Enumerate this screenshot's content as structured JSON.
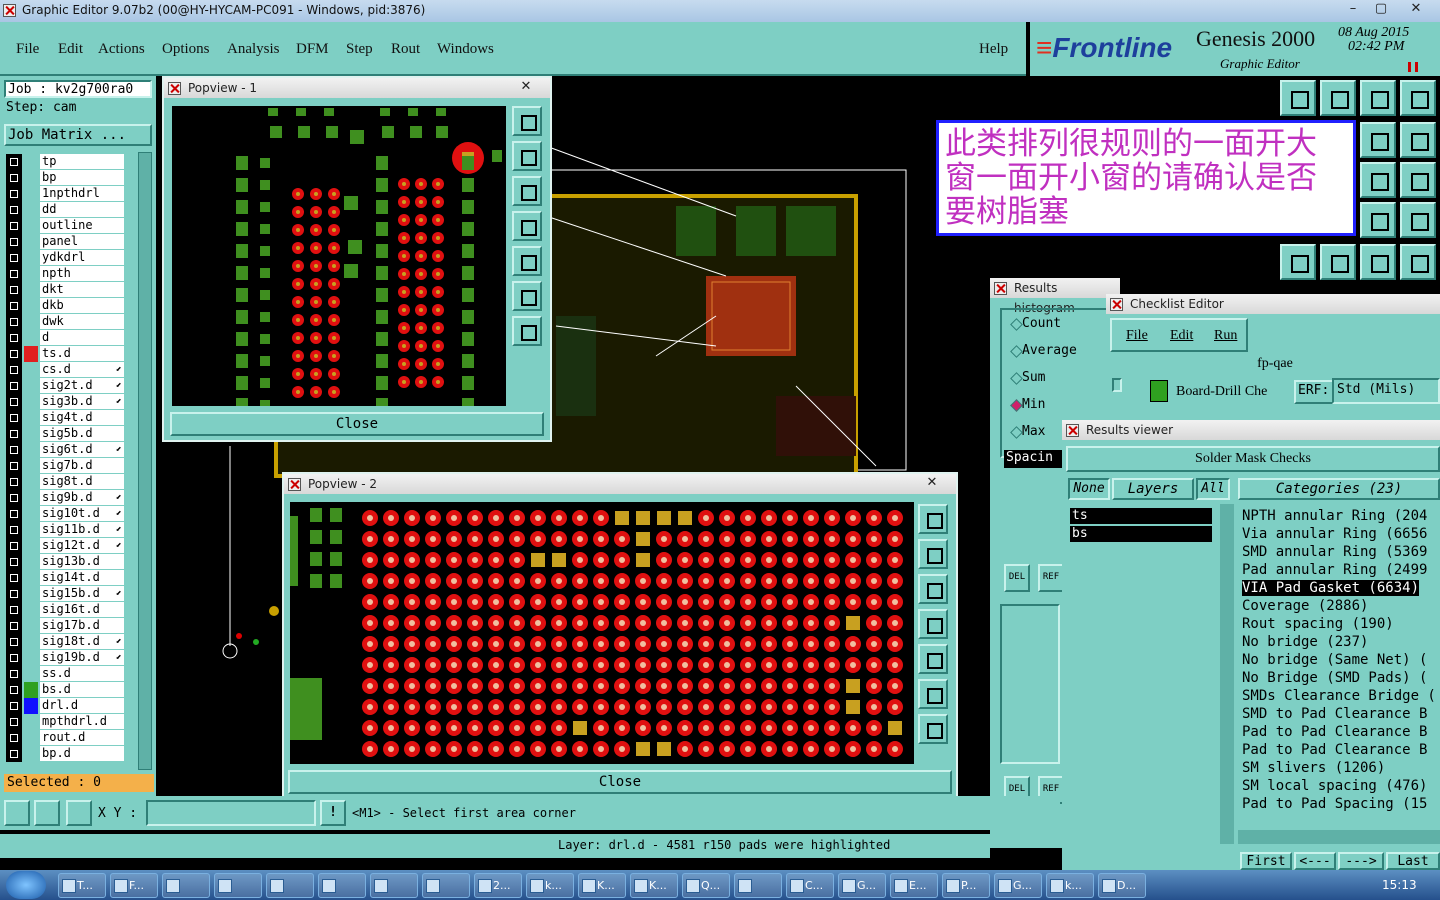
{
  "window": {
    "title": "Graphic Editor 9.07b2 (00@HY-HYCAM-PC091 - Windows, pid:3876)"
  },
  "menu": [
    "File",
    "Edit",
    "Actions",
    "Options",
    "Analysis",
    "DFM",
    "Step",
    "Rout",
    "Windows"
  ],
  "help_label": "Help",
  "brand": {
    "logo": "Frontline",
    "product": "Genesis 2000",
    "subtitle": "Graphic Editor",
    "date": "08 Aug 2015",
    "time": "02:42 PM"
  },
  "job": {
    "job_label": "Job : kv2g700ra0",
    "step_label": "Step: cam",
    "matrix_button": "Job Matrix ..."
  },
  "layers": [
    {
      "name": "tp",
      "color": ""
    },
    {
      "name": "bp",
      "color": ""
    },
    {
      "name": "1npthdrl",
      "color": ""
    },
    {
      "name": "dd",
      "color": ""
    },
    {
      "name": "outline",
      "color": ""
    },
    {
      "name": "panel",
      "color": ""
    },
    {
      "name": "ydkdrl",
      "color": ""
    },
    {
      "name": "npth",
      "color": ""
    },
    {
      "name": "dkt",
      "color": ""
    },
    {
      "name": "dkb",
      "color": ""
    },
    {
      "name": "dwk",
      "color": ""
    },
    {
      "name": "d",
      "color": ""
    },
    {
      "name": "ts.d",
      "color": "#e02020"
    },
    {
      "name": "cs.d",
      "color": ""
    },
    {
      "name": "sig2t.d",
      "color": ""
    },
    {
      "name": "sig3b.d",
      "color": ""
    },
    {
      "name": "sig4t.d",
      "color": ""
    },
    {
      "name": "sig5b.d",
      "color": ""
    },
    {
      "name": "sig6t.d",
      "color": ""
    },
    {
      "name": "sig7b.d",
      "color": ""
    },
    {
      "name": "sig8t.d",
      "color": ""
    },
    {
      "name": "sig9b.d",
      "color": ""
    },
    {
      "name": "sig10t.d",
      "color": ""
    },
    {
      "name": "sig11b.d",
      "color": ""
    },
    {
      "name": "sig12t.d",
      "color": ""
    },
    {
      "name": "sig13b.d",
      "color": ""
    },
    {
      "name": "sig14t.d",
      "color": ""
    },
    {
      "name": "sig15b.d",
      "color": ""
    },
    {
      "name": "sig16t.d",
      "color": ""
    },
    {
      "name": "sig17b.d",
      "color": ""
    },
    {
      "name": "sig18t.d",
      "color": ""
    },
    {
      "name": "sig19b.d",
      "color": ""
    },
    {
      "name": "ss.d",
      "color": ""
    },
    {
      "name": "bs.d",
      "color": "#2fa020"
    },
    {
      "name": "drl.d",
      "color": "#1010ff"
    },
    {
      "name": "mpthdrl.d",
      "color": ""
    },
    {
      "name": "rout.d",
      "color": ""
    },
    {
      "name": "bp.d",
      "color": ""
    }
  ],
  "selected_label": "Selected : 0",
  "xy_label": "X Y :",
  "prompt": "<M1> - Select first area corner",
  "status": "Layer: drl.d - 4581 r150 pads were highlighted",
  "popview1": {
    "title": "Popview - 1",
    "close": "Close"
  },
  "popview2": {
    "title": "Popview - 2",
    "close": "Close"
  },
  "annotation": "此类排列很规则的一面开大窗一面开小窗的请确认是否要树脂塞",
  "histogram": {
    "title": "Results histogram",
    "options": [
      "Count",
      "Average",
      "Sum",
      "Min",
      "Max"
    ],
    "selected": "Min",
    "field": "Spacin",
    "del": "DEL",
    "ref": "REF"
  },
  "checklist": {
    "title": "Checklist Editor",
    "menu": [
      "File",
      "Edit",
      "Run"
    ],
    "name": "fp-qae",
    "item": "Board-Drill Che",
    "erf": "ERF:",
    "units": "Std (Mils)"
  },
  "results": {
    "title": "Results viewer",
    "header": "Solder Mask Checks",
    "buttons": [
      "None",
      "Layers",
      "All"
    ],
    "categories_label": "Categories (23)",
    "layers": [
      "ts",
      "bs"
    ],
    "categories": [
      "NPTH annular Ring (204",
      "Via annular Ring (6656",
      "SMD annular Ring (5369",
      "Pad annular Ring (2499",
      "VIA Pad Gasket (6634)",
      "Coverage (2886)",
      "Rout spacing (190)",
      "No bridge (237)",
      "No bridge (Same Net) (",
      "No Bridge (SMD Pads) (",
      "SMDs Clearance Bridge (",
      "SMD to Pad Clearance B",
      "Pad to Pad Clearance B",
      "Pad to Pad Clearance B",
      "SM slivers (1206)",
      "SM local spacing (476)",
      "Pad to Pad Spacing (15"
    ],
    "selected_category": "VIA Pad Gasket (6634)",
    "nav": [
      "First",
      "<---",
      "--->",
      "Last"
    ]
  },
  "taskbar": {
    "items": [
      "T...",
      "F...",
      "",
      "",
      "",
      "",
      "",
      "",
      "2...",
      "k...",
      "K...",
      "K...",
      "Q...",
      "",
      "C...",
      "G...",
      "E...",
      "P...",
      "G...",
      "k...",
      "D..."
    ],
    "clock": "15:13"
  }
}
